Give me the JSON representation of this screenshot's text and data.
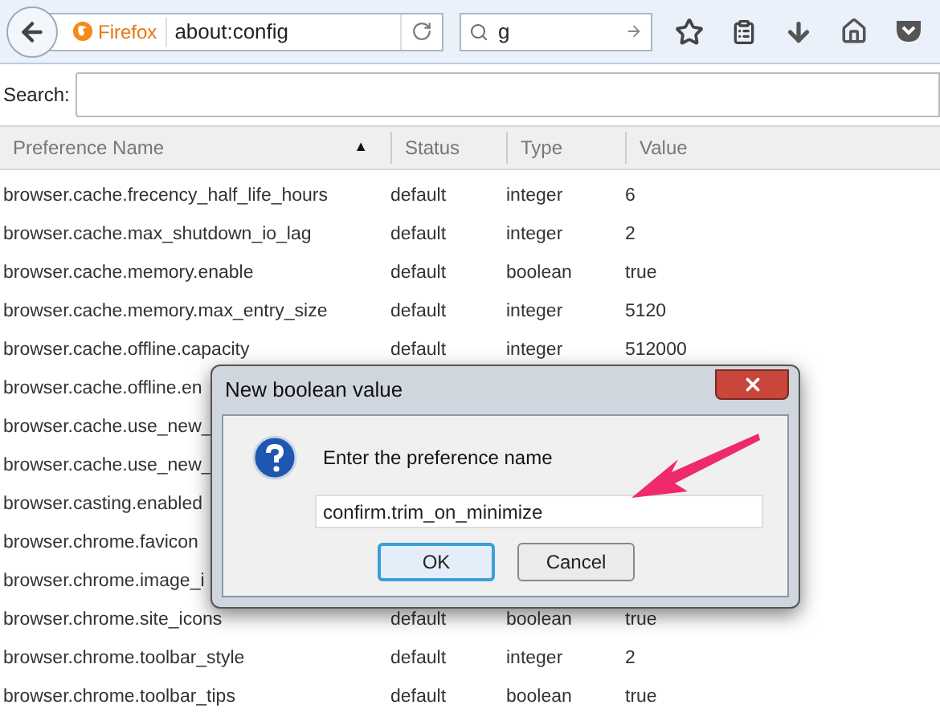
{
  "toolbar": {
    "brand": "Firefox",
    "url": "about:config",
    "search_query": "g"
  },
  "search": {
    "label": "Search:"
  },
  "table": {
    "columns": [
      {
        "label": "Preference Name",
        "sort_indicator": "▲"
      },
      {
        "label": "Status"
      },
      {
        "label": "Type"
      },
      {
        "label": "Value"
      }
    ],
    "rows": [
      {
        "name": "browser.cache.frecency_half_life_hours",
        "status": "default",
        "type": "integer",
        "value": "6"
      },
      {
        "name": "browser.cache.max_shutdown_io_lag",
        "status": "default",
        "type": "integer",
        "value": "2"
      },
      {
        "name": "browser.cache.memory.enable",
        "status": "default",
        "type": "boolean",
        "value": "true"
      },
      {
        "name": "browser.cache.memory.max_entry_size",
        "status": "default",
        "type": "integer",
        "value": "5120"
      },
      {
        "name": "browser.cache.offline.capacity",
        "status": "default",
        "type": "integer",
        "value": "512000"
      },
      {
        "name": "browser.cache.offline.en"
      },
      {
        "name": "browser.cache.use_new_"
      },
      {
        "name": "browser.cache.use_new_"
      },
      {
        "name": "browser.casting.enabled"
      },
      {
        "name": "browser.chrome.favicon"
      },
      {
        "name": "browser.chrome.image_i"
      },
      {
        "name": "browser.chrome.site_icons",
        "status": "default",
        "type": "boolean",
        "value": "true"
      },
      {
        "name": "browser.chrome.toolbar_style",
        "status": "default",
        "type": "integer",
        "value": "2"
      },
      {
        "name": "browser.chrome.toolbar_tips",
        "status": "default",
        "type": "boolean",
        "value": "true"
      }
    ]
  },
  "dialog": {
    "title": "New boolean value",
    "message": "Enter the preference name",
    "value": "confirm.trim_on_minimize",
    "buttons": [
      {
        "label": "OK",
        "default": true
      },
      {
        "label": "Cancel",
        "default": false
      }
    ]
  }
}
